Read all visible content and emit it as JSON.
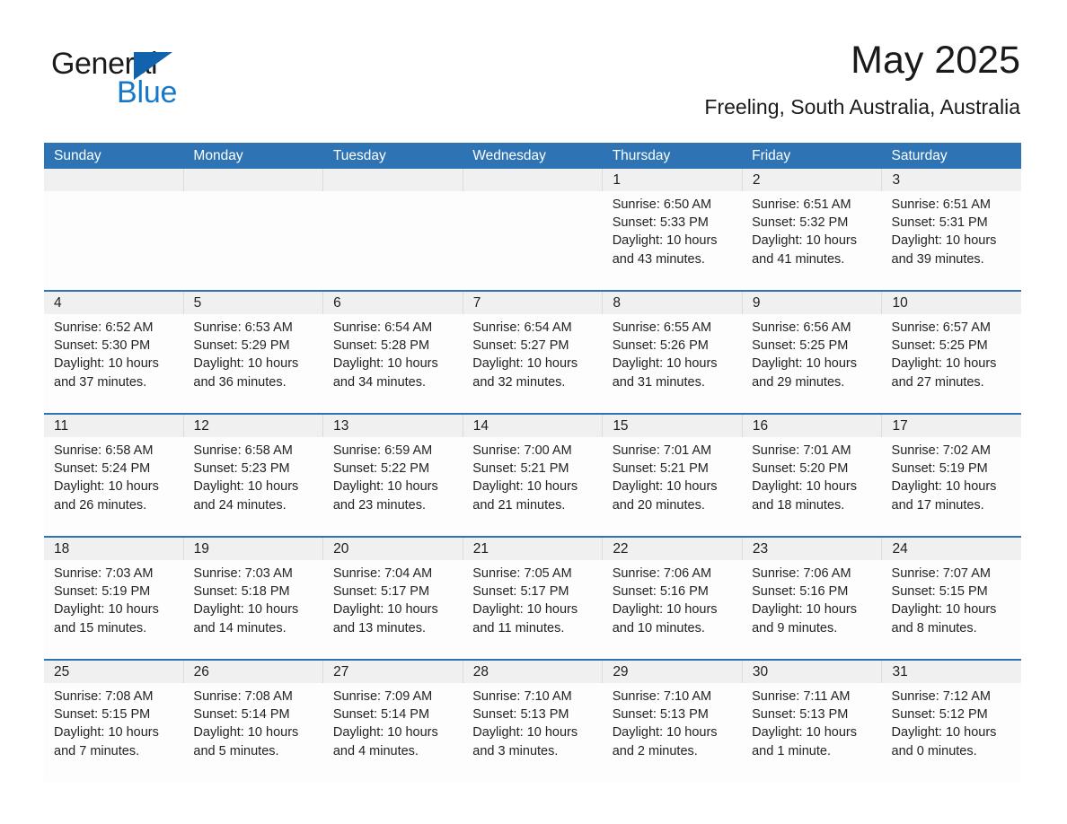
{
  "brand": {
    "name_part1": "General",
    "name_part2": "Blue",
    "triangle_color": "#1163ad",
    "blue_color": "#1878c8"
  },
  "header": {
    "month_title": "May 2025",
    "location": "Freeling, South Australia, Australia"
  },
  "theme": {
    "header_bar_color": "#2e74b5",
    "daynum_band_color": "#f0f0f0",
    "row_divider_color": "#2e74b5"
  },
  "weekdays": [
    "Sunday",
    "Monday",
    "Tuesday",
    "Wednesday",
    "Thursday",
    "Friday",
    "Saturday"
  ],
  "weeks": [
    {
      "days": [
        {
          "num": "",
          "sunrise": "",
          "sunset": "",
          "daylight": ""
        },
        {
          "num": "",
          "sunrise": "",
          "sunset": "",
          "daylight": ""
        },
        {
          "num": "",
          "sunrise": "",
          "sunset": "",
          "daylight": ""
        },
        {
          "num": "",
          "sunrise": "",
          "sunset": "",
          "daylight": ""
        },
        {
          "num": "1",
          "sunrise": "Sunrise: 6:50 AM",
          "sunset": "Sunset: 5:33 PM",
          "daylight": "Daylight: 10 hours and 43 minutes."
        },
        {
          "num": "2",
          "sunrise": "Sunrise: 6:51 AM",
          "sunset": "Sunset: 5:32 PM",
          "daylight": "Daylight: 10 hours and 41 minutes."
        },
        {
          "num": "3",
          "sunrise": "Sunrise: 6:51 AM",
          "sunset": "Sunset: 5:31 PM",
          "daylight": "Daylight: 10 hours and 39 minutes."
        }
      ]
    },
    {
      "days": [
        {
          "num": "4",
          "sunrise": "Sunrise: 6:52 AM",
          "sunset": "Sunset: 5:30 PM",
          "daylight": "Daylight: 10 hours and 37 minutes."
        },
        {
          "num": "5",
          "sunrise": "Sunrise: 6:53 AM",
          "sunset": "Sunset: 5:29 PM",
          "daylight": "Daylight: 10 hours and 36 minutes."
        },
        {
          "num": "6",
          "sunrise": "Sunrise: 6:54 AM",
          "sunset": "Sunset: 5:28 PM",
          "daylight": "Daylight: 10 hours and 34 minutes."
        },
        {
          "num": "7",
          "sunrise": "Sunrise: 6:54 AM",
          "sunset": "Sunset: 5:27 PM",
          "daylight": "Daylight: 10 hours and 32 minutes."
        },
        {
          "num": "8",
          "sunrise": "Sunrise: 6:55 AM",
          "sunset": "Sunset: 5:26 PM",
          "daylight": "Daylight: 10 hours and 31 minutes."
        },
        {
          "num": "9",
          "sunrise": "Sunrise: 6:56 AM",
          "sunset": "Sunset: 5:25 PM",
          "daylight": "Daylight: 10 hours and 29 minutes."
        },
        {
          "num": "10",
          "sunrise": "Sunrise: 6:57 AM",
          "sunset": "Sunset: 5:25 PM",
          "daylight": "Daylight: 10 hours and 27 minutes."
        }
      ]
    },
    {
      "days": [
        {
          "num": "11",
          "sunrise": "Sunrise: 6:58 AM",
          "sunset": "Sunset: 5:24 PM",
          "daylight": "Daylight: 10 hours and 26 minutes."
        },
        {
          "num": "12",
          "sunrise": "Sunrise: 6:58 AM",
          "sunset": "Sunset: 5:23 PM",
          "daylight": "Daylight: 10 hours and 24 minutes."
        },
        {
          "num": "13",
          "sunrise": "Sunrise: 6:59 AM",
          "sunset": "Sunset: 5:22 PM",
          "daylight": "Daylight: 10 hours and 23 minutes."
        },
        {
          "num": "14",
          "sunrise": "Sunrise: 7:00 AM",
          "sunset": "Sunset: 5:21 PM",
          "daylight": "Daylight: 10 hours and 21 minutes."
        },
        {
          "num": "15",
          "sunrise": "Sunrise: 7:01 AM",
          "sunset": "Sunset: 5:21 PM",
          "daylight": "Daylight: 10 hours and 20 minutes."
        },
        {
          "num": "16",
          "sunrise": "Sunrise: 7:01 AM",
          "sunset": "Sunset: 5:20 PM",
          "daylight": "Daylight: 10 hours and 18 minutes."
        },
        {
          "num": "17",
          "sunrise": "Sunrise: 7:02 AM",
          "sunset": "Sunset: 5:19 PM",
          "daylight": "Daylight: 10 hours and 17 minutes."
        }
      ]
    },
    {
      "days": [
        {
          "num": "18",
          "sunrise": "Sunrise: 7:03 AM",
          "sunset": "Sunset: 5:19 PM",
          "daylight": "Daylight: 10 hours and 15 minutes."
        },
        {
          "num": "19",
          "sunrise": "Sunrise: 7:03 AM",
          "sunset": "Sunset: 5:18 PM",
          "daylight": "Daylight: 10 hours and 14 minutes."
        },
        {
          "num": "20",
          "sunrise": "Sunrise: 7:04 AM",
          "sunset": "Sunset: 5:17 PM",
          "daylight": "Daylight: 10 hours and 13 minutes."
        },
        {
          "num": "21",
          "sunrise": "Sunrise: 7:05 AM",
          "sunset": "Sunset: 5:17 PM",
          "daylight": "Daylight: 10 hours and 11 minutes."
        },
        {
          "num": "22",
          "sunrise": "Sunrise: 7:06 AM",
          "sunset": "Sunset: 5:16 PM",
          "daylight": "Daylight: 10 hours and 10 minutes."
        },
        {
          "num": "23",
          "sunrise": "Sunrise: 7:06 AM",
          "sunset": "Sunset: 5:16 PM",
          "daylight": "Daylight: 10 hours and 9 minutes."
        },
        {
          "num": "24",
          "sunrise": "Sunrise: 7:07 AM",
          "sunset": "Sunset: 5:15 PM",
          "daylight": "Daylight: 10 hours and 8 minutes."
        }
      ]
    },
    {
      "days": [
        {
          "num": "25",
          "sunrise": "Sunrise: 7:08 AM",
          "sunset": "Sunset: 5:15 PM",
          "daylight": "Daylight: 10 hours and 7 minutes."
        },
        {
          "num": "26",
          "sunrise": "Sunrise: 7:08 AM",
          "sunset": "Sunset: 5:14 PM",
          "daylight": "Daylight: 10 hours and 5 minutes."
        },
        {
          "num": "27",
          "sunrise": "Sunrise: 7:09 AM",
          "sunset": "Sunset: 5:14 PM",
          "daylight": "Daylight: 10 hours and 4 minutes."
        },
        {
          "num": "28",
          "sunrise": "Sunrise: 7:10 AM",
          "sunset": "Sunset: 5:13 PM",
          "daylight": "Daylight: 10 hours and 3 minutes."
        },
        {
          "num": "29",
          "sunrise": "Sunrise: 7:10 AM",
          "sunset": "Sunset: 5:13 PM",
          "daylight": "Daylight: 10 hours and 2 minutes."
        },
        {
          "num": "30",
          "sunrise": "Sunrise: 7:11 AM",
          "sunset": "Sunset: 5:13 PM",
          "daylight": "Daylight: 10 hours and 1 minute."
        },
        {
          "num": "31",
          "sunrise": "Sunrise: 7:12 AM",
          "sunset": "Sunset: 5:12 PM",
          "daylight": "Daylight: 10 hours and 0 minutes."
        }
      ]
    }
  ]
}
